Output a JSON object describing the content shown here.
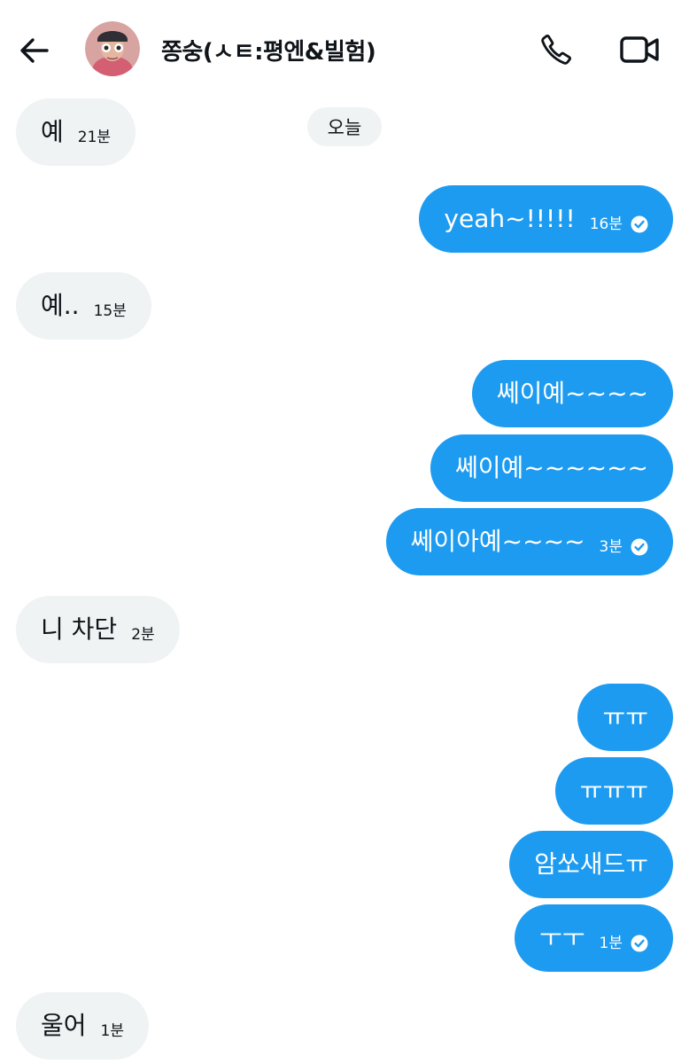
{
  "header": {
    "contact_name": "쫑숭(ㅅㅌ:평엔&빌험)",
    "icons": {
      "back": "arrow-left-icon",
      "call": "phone-icon",
      "video": "video-camera-icon"
    }
  },
  "date_separator": "오늘",
  "messages": [
    {
      "direction": "in",
      "text": "예",
      "time": "21분"
    },
    {
      "direction": "out",
      "text": "yeah~!!!!!",
      "time": "16분",
      "read": true
    },
    {
      "direction": "in",
      "text": "예..",
      "time": "15분"
    },
    {
      "direction": "out",
      "text": "쎄이예~~~~"
    },
    {
      "direction": "out",
      "text": "쎄이예~~~~~~"
    },
    {
      "direction": "out",
      "text": "쎄이아예~~~~",
      "time": "3분",
      "read": true
    },
    {
      "direction": "in",
      "text": "니 차단",
      "time": "2분"
    },
    {
      "direction": "out",
      "text": "ㅠㅠ"
    },
    {
      "direction": "out",
      "text": "ㅠㅠㅠ"
    },
    {
      "direction": "out",
      "text": "암쏘새드ㅠ"
    },
    {
      "direction": "out",
      "text": "ㅜㅜ",
      "time": "1분",
      "read": true
    },
    {
      "direction": "in",
      "text": "울어",
      "time": "1분"
    }
  ],
  "colors": {
    "outgoing_bubble": "#1d9bf0",
    "incoming_bubble": "#eff3f4",
    "text_primary": "#0f1419",
    "background": "#ffffff"
  }
}
